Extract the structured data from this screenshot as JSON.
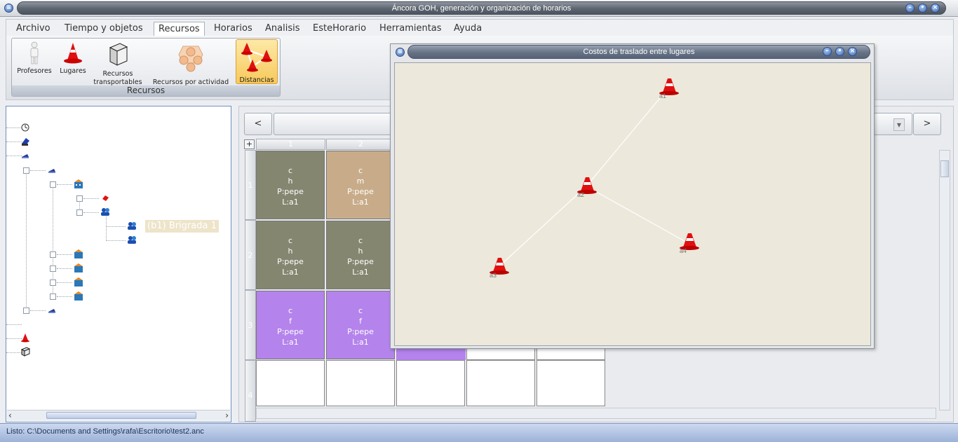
{
  "window": {
    "title": "Áncora GOH, generación y organización de horarios"
  },
  "menu": [
    "Archivo",
    "Tiempo y objetos",
    "Recursos",
    "Horarios",
    "Analisis",
    "EsteHorario",
    "Herramientas",
    "Ayuda"
  ],
  "ribbon": {
    "group_label": "Recursos",
    "buttons": {
      "profesores": "Profesores",
      "lugares": "Lugares",
      "transportables_1": "Recursos",
      "transportables_2": "transportables",
      "por_actividad": "Recursos por actividad",
      "distancias": "Distancias"
    }
  },
  "tree": {
    "selected_label": "(b1) Brigrada 1"
  },
  "schedule": {
    "prev": "<",
    "next": ">",
    "add": "+",
    "columns": [
      "1",
      "2"
    ],
    "rows": [
      "1",
      "2",
      "3",
      "4"
    ],
    "cells": [
      {
        "l1": "c",
        "l2": "h",
        "l3": "P:pepe",
        "l4": "L:a1",
        "color": "#858670"
      },
      {
        "l1": "c",
        "l2": "m",
        "l3": "P:pepe",
        "l4": "L:a1",
        "color": "#c8ac8a"
      },
      {
        "l1": "c",
        "l2": "h",
        "l3": "P:pepe",
        "l4": "L:a1",
        "color": "#858670"
      },
      {
        "l1": "c",
        "l2": "h",
        "l3": "P:pepe",
        "l4": "L:a1",
        "color": "#858670"
      },
      {
        "l1": "c",
        "l2": "f",
        "l3": "P:pepe",
        "l4": "L:a1",
        "color": "#b483ec"
      },
      {
        "l1": "c",
        "l2": "f",
        "l3": "P:pepe",
        "l4": "L:a1",
        "color": "#b483ec"
      }
    ]
  },
  "dialog": {
    "title": "Costos de traslado entre lugares",
    "places": [
      {
        "label": "a1"
      },
      {
        "label": "a2"
      },
      {
        "label": "a3"
      },
      {
        "label": "a4"
      }
    ]
  },
  "status": {
    "text": "Listo: C:\\Documents and Settings\\rafa\\Escritorio\\test2.anc"
  },
  "colors": {
    "accent": "#3e6cb8",
    "cone": "#e01010",
    "selected_ribbon": "#f7c95a"
  }
}
